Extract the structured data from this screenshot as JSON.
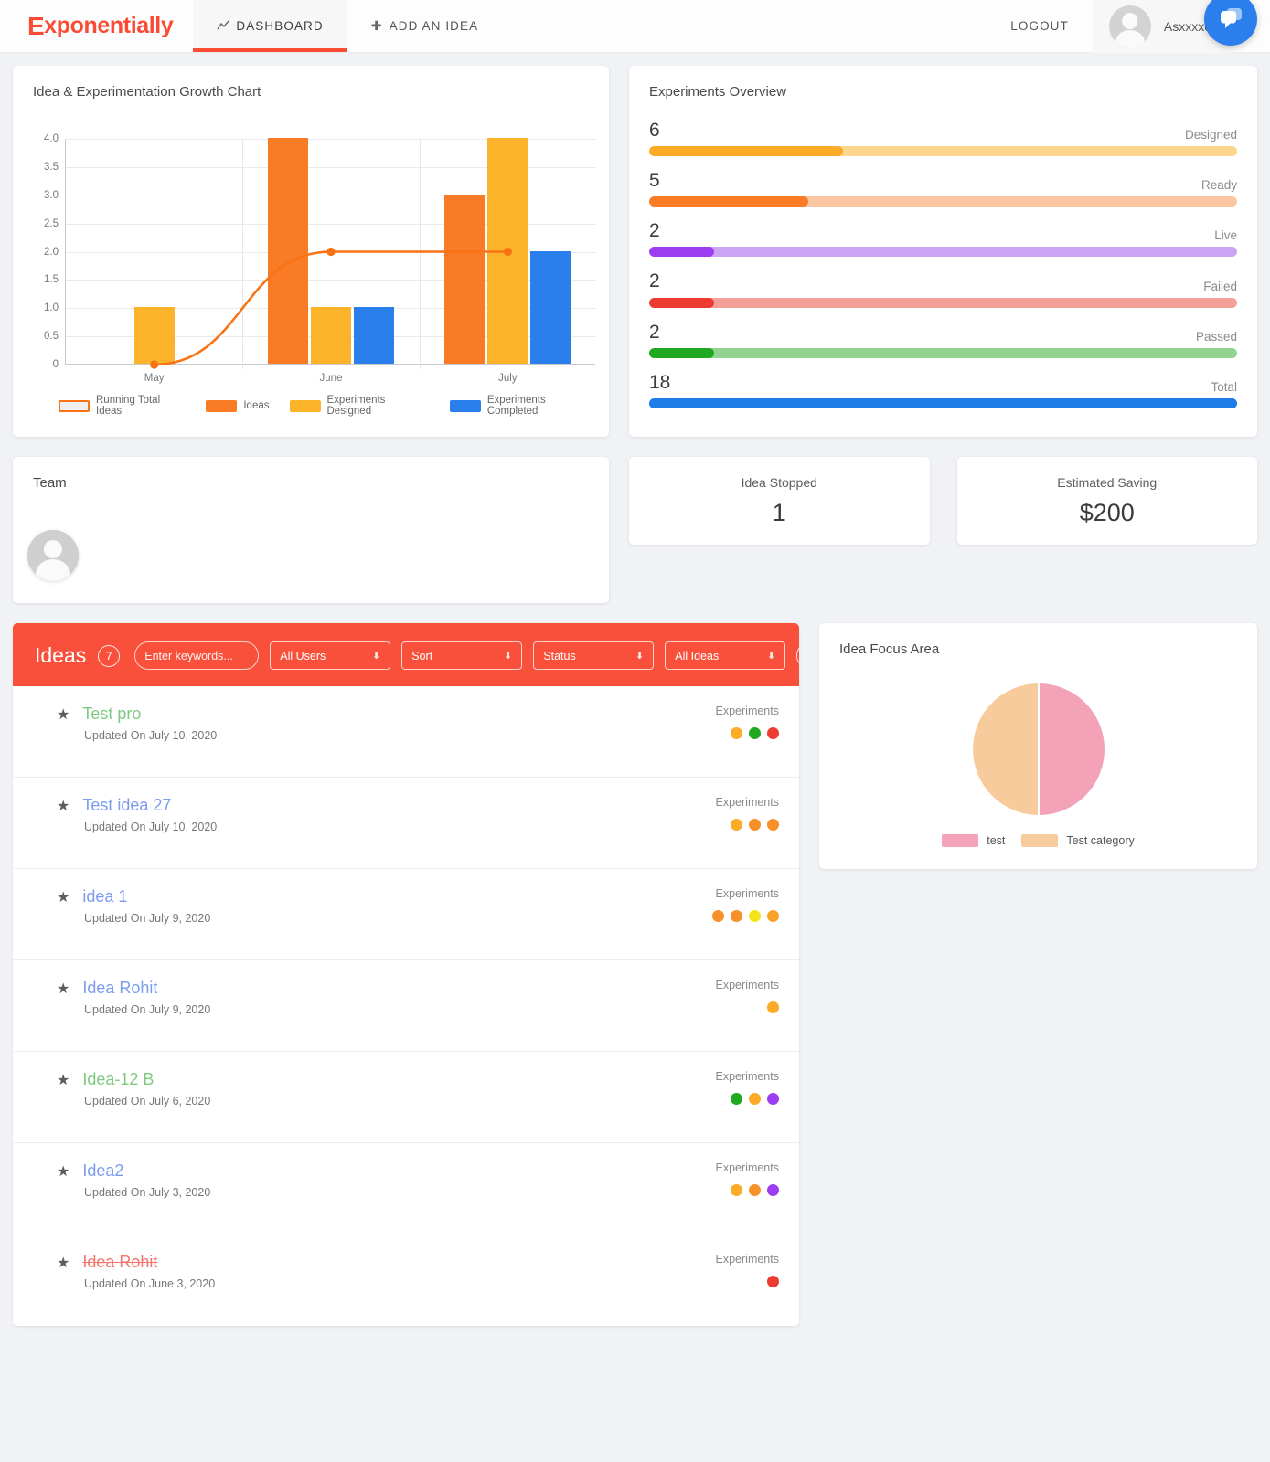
{
  "navbar": {
    "brand_first": "E",
    "brand_rest": "xponentially",
    "links": [
      {
        "label": "DASHBOARD",
        "icon": "speedometer-icon",
        "glyph": "↗",
        "active": true
      },
      {
        "label": "ADD AN IDEA",
        "icon": "plus-icon",
        "glyph": "✚",
        "active": false
      }
    ],
    "logout_label": "LOGOUT",
    "username": "Asxxxxe",
    "chat_icon": "chat-bubble-icon"
  },
  "growth": {
    "title": "Idea & Experimentation Growth Chart"
  },
  "chart_data": {
    "type": "bar",
    "title": "Idea & Experimentation Growth Chart",
    "categories": [
      "May",
      "June",
      "July"
    ],
    "xlabel": "",
    "ylabel": "",
    "ylim": [
      0,
      4
    ],
    "yticks": [
      "0",
      "0.5",
      "1.0",
      "1.5",
      "2.0",
      "2.5",
      "3.0",
      "3.5",
      "4.0"
    ],
    "grid": true,
    "legend_position": "bottom",
    "series": [
      {
        "name": "Running Total Ideas",
        "type": "line",
        "color": "#f97316",
        "values": [
          0,
          2,
          2
        ]
      },
      {
        "name": "Ideas",
        "type": "bar",
        "color": "#f97b25",
        "values": [
          0,
          4,
          3
        ]
      },
      {
        "name": "Experiments Designed",
        "type": "bar",
        "color": "#fbb32a",
        "values": [
          1,
          1,
          4
        ]
      },
      {
        "name": "Experiments Completed",
        "type": "bar",
        "color": "#2a7fec",
        "values": [
          0,
          1,
          2
        ]
      }
    ]
  },
  "experiments": {
    "title": "Experiments Overview",
    "rows": [
      {
        "value": "6",
        "label": "Designed",
        "percent": 33,
        "fill": "#fbab28",
        "track": "#fdd68d"
      },
      {
        "value": "5",
        "label": "Ready",
        "percent": 27,
        "fill": "#f97b25",
        "track": "#fbc6a2"
      },
      {
        "value": "2",
        "label": "Live",
        "percent": 11,
        "fill": "#9b3ef2",
        "track": "#cda5f5"
      },
      {
        "value": "2",
        "label": "Failed",
        "percent": 11,
        "fill": "#ee3b32",
        "track": "#f3a098"
      },
      {
        "value": "2",
        "label": "Passed",
        "percent": 11,
        "fill": "#1fa820",
        "track": "#92d38f"
      },
      {
        "value": "18",
        "label": "Total",
        "percent": 100,
        "fill": "#1e7ce8",
        "track": "#1e7ce8"
      }
    ]
  },
  "team": {
    "title": "Team",
    "avatar": "user-avatar"
  },
  "stats": [
    {
      "label": "Idea Stopped",
      "value": "1"
    },
    {
      "label": "Estimated Saving",
      "value": "$200"
    }
  ],
  "ideas": {
    "title": "Ideas",
    "count": "7",
    "search_placeholder": "Enter keywords...",
    "filters": [
      {
        "name": "users-filter",
        "value": "All Users"
      },
      {
        "name": "sort-filter",
        "value": "Sort"
      },
      {
        "name": "status-filter",
        "value": "Status"
      },
      {
        "name": "scope-filter",
        "value": "All Ideas"
      }
    ],
    "search_icon": "search-icon",
    "experiments_caption": "Experiments",
    "items": [
      {
        "name": "Test pro",
        "color": "#7dc97f",
        "strike": false,
        "date": "Updated On July 10, 2020",
        "dots": [
          "#fbab28",
          "#1fa820",
          "#ee3b32"
        ]
      },
      {
        "name": "Test idea 27",
        "color": "#7b9cf0",
        "strike": false,
        "date": "Updated On July 10, 2020",
        "dots": [
          "#fbab28",
          "#f8902a",
          "#f8902a"
        ]
      },
      {
        "name": "idea 1",
        "color": "#7b9cf0",
        "strike": false,
        "date": "Updated On July 9, 2020",
        "dots": [
          "#f8902a",
          "#f8902a",
          "#f5e41c",
          "#f8a22a"
        ]
      },
      {
        "name": "Idea Rohit",
        "color": "#7b9cf0",
        "strike": false,
        "date": "Updated On July 9, 2020",
        "dots": [
          "#fbab28"
        ]
      },
      {
        "name": "Idea-12 B",
        "color": "#7dc97f",
        "strike": false,
        "date": "Updated On July 6, 2020",
        "dots": [
          "#1fa820",
          "#fbab28",
          "#9b3ef2"
        ]
      },
      {
        "name": "Idea2",
        "color": "#7b9cf0",
        "strike": false,
        "date": "Updated On July 3, 2020",
        "dots": [
          "#fbab28",
          "#f8902a",
          "#9b3ef2"
        ]
      },
      {
        "name": "Idea Rohit",
        "color": "#f4756b",
        "strike": true,
        "date": "Updated On June 3, 2020",
        "dots": [
          "#ee3b32"
        ]
      }
    ]
  },
  "focus": {
    "title": "Idea Focus Area",
    "chart": {
      "type": "pie",
      "title": "Idea Focus Area",
      "labels": [
        "test",
        "Test category"
      ],
      "values": [
        50,
        50
      ],
      "colors": [
        "#f3a2b8",
        "#f8cb9c"
      ],
      "legend_position": "bottom"
    }
  }
}
